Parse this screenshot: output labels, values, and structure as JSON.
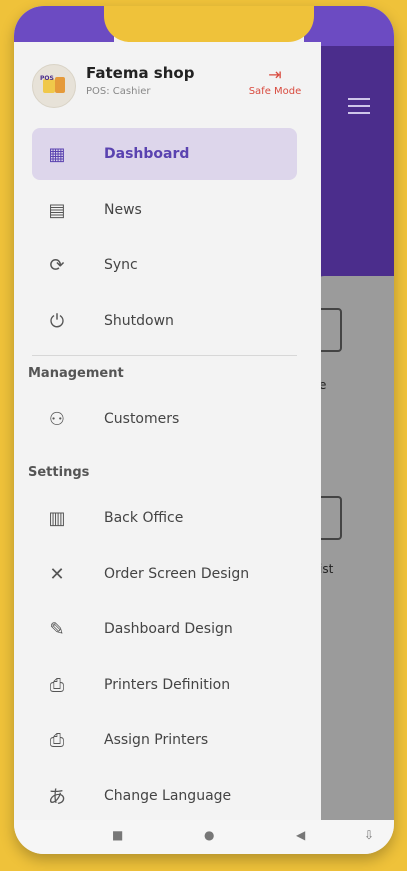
{
  "header": {
    "shop_name": "Fatema shop",
    "shop_sub": "POS: Cashier",
    "safe_mode_label": "Safe Mode"
  },
  "menu": {
    "dashboard": "Dashboard",
    "news": "News",
    "sync": "Sync",
    "shutdown": "Shutdown"
  },
  "sections": {
    "management": "Management",
    "settings": "Settings"
  },
  "management_items": {
    "customers": "Customers"
  },
  "settings_items": {
    "back_office": "Back Office",
    "order_screen_design": "Order Screen Design",
    "dashboard_design": "Dashboard Design",
    "printers_definition": "Printers Definition",
    "assign_printers": "Assign Printers",
    "change_language": "Change Language"
  },
  "background": {
    "label_partial_1": "e",
    "label_partial_2": "ist"
  },
  "colors": {
    "accent": "#5a43b0",
    "active_bg": "#ddd6eb",
    "safe_mode": "#d94b3f",
    "brand_purple": "#6c4bc2",
    "page_bg": "#efc23a"
  },
  "icons": {
    "dashboard": "grid-icon",
    "news": "newspaper-icon",
    "sync": "sync-icon",
    "shutdown": "power-icon",
    "customers": "people-icon",
    "back_office": "building-icon",
    "order_screen_design": "tools-icon",
    "dashboard_design": "design-icon",
    "printers_definition": "printer-icon",
    "assign_printers": "printer-settings-icon",
    "change_language": "language-icon"
  }
}
